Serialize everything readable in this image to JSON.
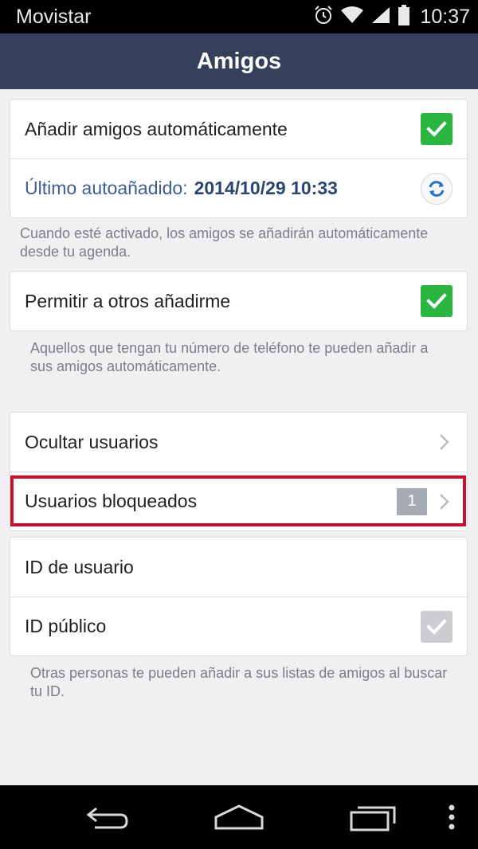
{
  "status_bar": {
    "carrier": "Movistar",
    "time": "10:37",
    "icons": [
      "alarm-icon",
      "wifi-icon",
      "signal-icon",
      "battery-icon"
    ]
  },
  "app_bar": {
    "title": "Amigos"
  },
  "section_auto_add": {
    "auto_add_label": "Añadir amigos automáticamente",
    "auto_add_checked": true,
    "last_added_label": "Último autoañadido:",
    "last_added_value": "2014/10/29 10:33",
    "hint": "Cuando esté activado, los amigos se añadirán automáticamente desde tu agenda."
  },
  "section_allow": {
    "allow_label": "Permitir a otros añadirme",
    "allow_checked": true,
    "hint": "Aquellos que tengan tu número de teléfono te pueden añadir a sus amigos automáticamente."
  },
  "section_users": {
    "hide_users_label": "Ocultar usuarios",
    "blocked_users_label": "Usuarios bloqueados",
    "blocked_count": "1"
  },
  "section_id": {
    "user_id_label": "ID de usuario",
    "public_id_label": "ID público",
    "public_id_checked": true,
    "public_id_enabled": false,
    "hint": "Otras personas te pueden añadir a sus listas de amigos al buscar tu ID."
  },
  "nav_bar": {
    "icons": [
      "back-icon",
      "home-icon",
      "recent-apps-icon",
      "overflow-menu-icon"
    ]
  },
  "colors": {
    "app_bar": "#34405a",
    "check_on": "#2ab440",
    "check_disabled": "#cbcdd1",
    "highlight": "#c8102e",
    "link_text": "#3e5e8f"
  }
}
